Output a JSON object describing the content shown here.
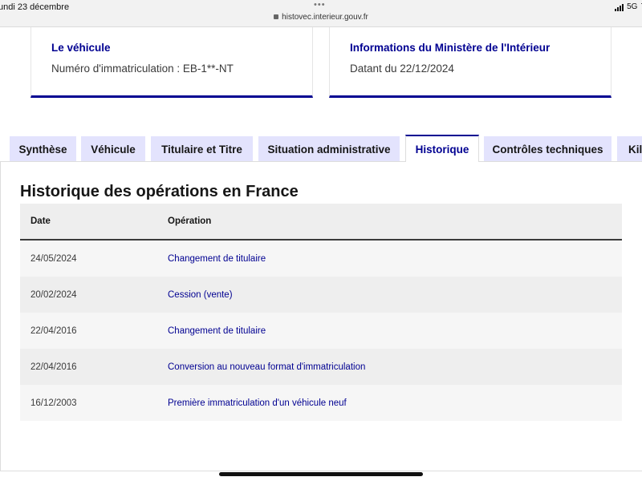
{
  "status_bar": {
    "date": "undi 23 décembre",
    "url": "histovec.interieur.gouv.fr",
    "network": "5G",
    "battery_partial": "7"
  },
  "cards": {
    "vehicle": {
      "title": "Le véhicule",
      "text": "Numéro d'immatriculation : EB-1**-NT"
    },
    "ministry": {
      "title": "Informations du Ministère de l'Intérieur",
      "text": "Datant du 22/12/2024"
    }
  },
  "tabs": [
    {
      "label": "Synthèse"
    },
    {
      "label": "Véhicule"
    },
    {
      "label": "Titulaire et Titre"
    },
    {
      "label": "Situation administrative"
    },
    {
      "label": "Historique",
      "active": true
    },
    {
      "label": "Contrôles techniques"
    },
    {
      "label": "Kilométrage"
    }
  ],
  "history": {
    "title": "Historique des opérations en France",
    "columns": {
      "date": "Date",
      "operation": "Opération"
    },
    "rows": [
      {
        "date": "24/05/2024",
        "operation": "Changement de titulaire"
      },
      {
        "date": "20/02/2024",
        "operation": "Cession (vente)"
      },
      {
        "date": "22/04/2016",
        "operation": "Changement de titulaire"
      },
      {
        "date": "22/04/2016",
        "operation": "Conversion au nouveau format d'immatriculation"
      },
      {
        "date": "16/12/2003",
        "operation": "Première immatriculation d'un véhicule neuf"
      }
    ]
  },
  "colors": {
    "accent": "#000091",
    "tab_inactive": "#e3e3fd",
    "row_light": "#f6f6f6",
    "row_dark": "#eeeeee"
  }
}
